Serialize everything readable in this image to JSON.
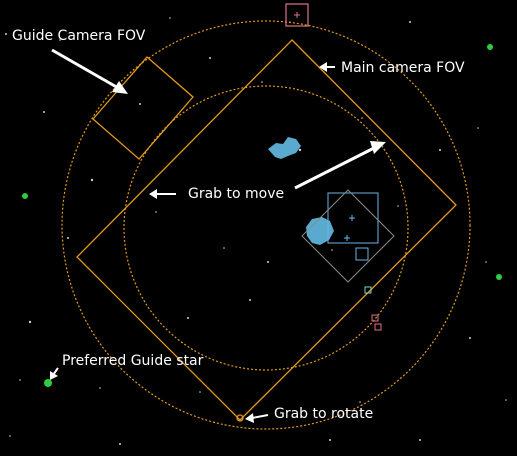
{
  "annotations": {
    "guide_camera_fov": "Guide Camera FOV",
    "main_camera_fov": "Main camera FOV",
    "grab_to_move": "Grab to move",
    "grab_to_rotate": "Grab to rotate",
    "preferred_guide_star": "Preferred Guide star"
  },
  "colors": {
    "background": "#000000",
    "fov_outline": "#e09a1e",
    "annotation_text": "#ffffff",
    "guide_star": "#2ecc40",
    "galaxy_fill": "#5aaad0",
    "inset_outline": "#6ab4e6",
    "marker_pink": "#e0708a",
    "marker_teal": "#7cd4c8"
  },
  "icons": [
    "arrow-icon",
    "guide-star-icon",
    "rotate-handle-icon",
    "galaxy-icon",
    "crosshair-icon"
  ]
}
